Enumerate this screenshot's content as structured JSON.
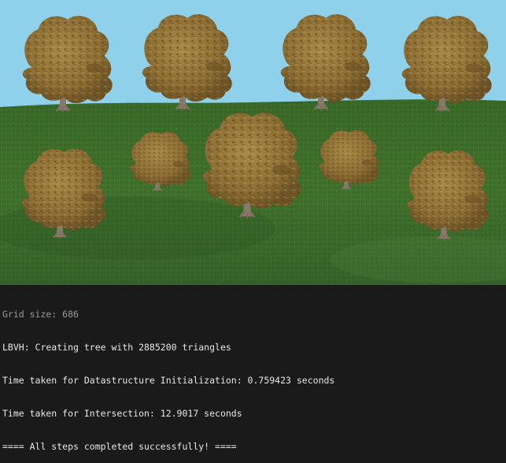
{
  "scene": {
    "sky_color": "#8fd0ea",
    "grass_color": "#3e6b2a",
    "canopy_color": "#9a7b3d",
    "trunk_color": "#8c7a6b"
  },
  "terminal": {
    "lines": [
      "Grid size: 686",
      "LBVH: Creating tree with 2885200 triangles",
      "Time taken for Datastructure Initialization: 0.759423 seconds",
      "Time taken for Intersection: 12.9017 seconds",
      "==== All steps completed successfully! ===="
    ]
  }
}
